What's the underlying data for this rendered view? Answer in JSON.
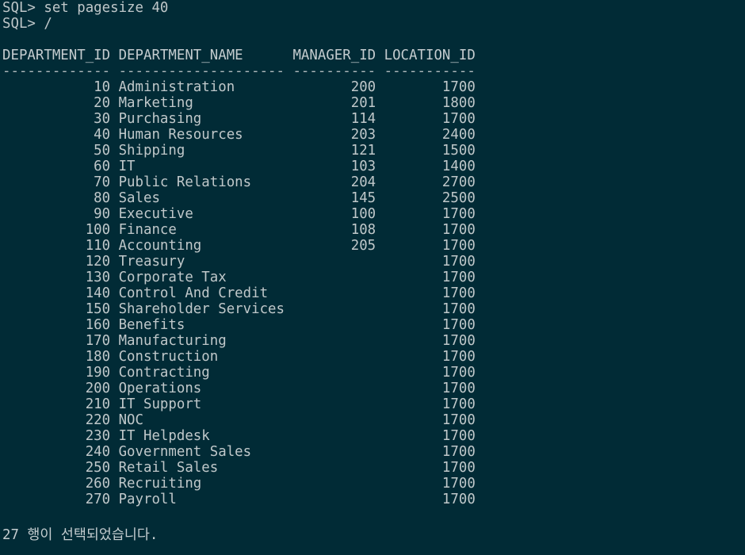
{
  "terminal": {
    "commands": [
      "SQL> set pagesize 40",
      "SQL> /"
    ],
    "header": "DEPARTMENT_ID DEPARTMENT_NAME      MANAGER_ID LOCATION_ID",
    "separator": "------------- -------------------- ---------- -----------",
    "rows": [
      "           10 Administration              200        1700",
      "           20 Marketing                   201        1800",
      "           30 Purchasing                  114        1700",
      "           40 Human Resources             203        2400",
      "           50 Shipping                    121        1500",
      "           60 IT                          103        1400",
      "           70 Public Relations            204        2700",
      "           80 Sales                       145        2500",
      "           90 Executive                   100        1700",
      "          100 Finance                     108        1700",
      "          110 Accounting                  205        1700",
      "          120 Treasury                               1700",
      "          130 Corporate Tax                          1700",
      "          140 Control And Credit                     1700",
      "          150 Shareholder Services                   1700",
      "          160 Benefits                               1700",
      "          170 Manufacturing                          1700",
      "          180 Construction                           1700",
      "          190 Contracting                            1700",
      "          200 Operations                             1700",
      "          210 IT Support                             1700",
      "          220 NOC                                    1700",
      "          230 IT Helpdesk                            1700",
      "          240 Government Sales                       1700",
      "          250 Retail Sales                           1700",
      "          260 Recruiting                             1700",
      "          270 Payroll                                1700"
    ],
    "footer": "27 행이 선택되었습니다."
  },
  "colors": {
    "background": "#012b36",
    "text": "#bfc7c9"
  }
}
